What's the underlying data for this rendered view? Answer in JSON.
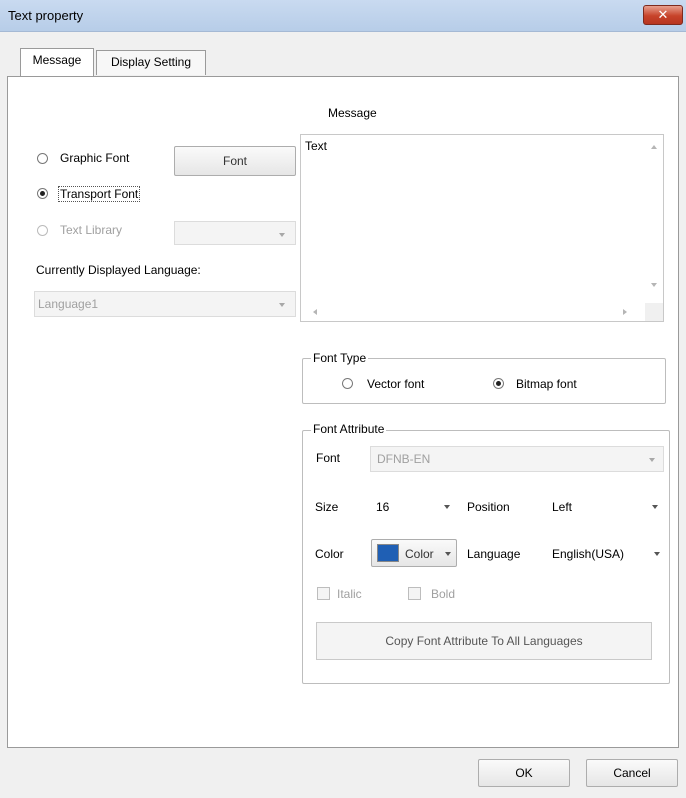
{
  "window": {
    "title": "Text property",
    "close_label": "✕"
  },
  "tabs": [
    {
      "label": "Message"
    },
    {
      "label": "Display Setting"
    }
  ],
  "message": {
    "header": "Message",
    "text": "Text"
  },
  "left": {
    "graphic_font_label": "Graphic Font",
    "font_button_label": "Font",
    "transport_font_label": "Transport Font",
    "text_library_label": "Text Library",
    "text_library_value": "",
    "language_label": "Currently Displayed Language:",
    "language_value": "Language1",
    "selected_source": "Transport Font"
  },
  "font_type": {
    "title": "Font Type",
    "vector_label": "Vector font",
    "bitmap_label": "Bitmap font",
    "selected": "Bitmap font"
  },
  "font_attribute": {
    "title": "Font Attribute",
    "font_label": "Font",
    "font_value": "DFNB-EN",
    "size_label": "Size",
    "size_value": "16",
    "position_label": "Position",
    "position_value": "Left",
    "color_label": "Color",
    "color_button_label": "Color",
    "color_swatch": "#1f5fb4",
    "language_label": "Language",
    "language_value": "English(USA)",
    "italic_label": "Italic",
    "bold_label": "Bold",
    "copy_button_label": "Copy Font Attribute To All Languages"
  },
  "footer": {
    "ok_label": "OK",
    "cancel_label": "Cancel"
  }
}
